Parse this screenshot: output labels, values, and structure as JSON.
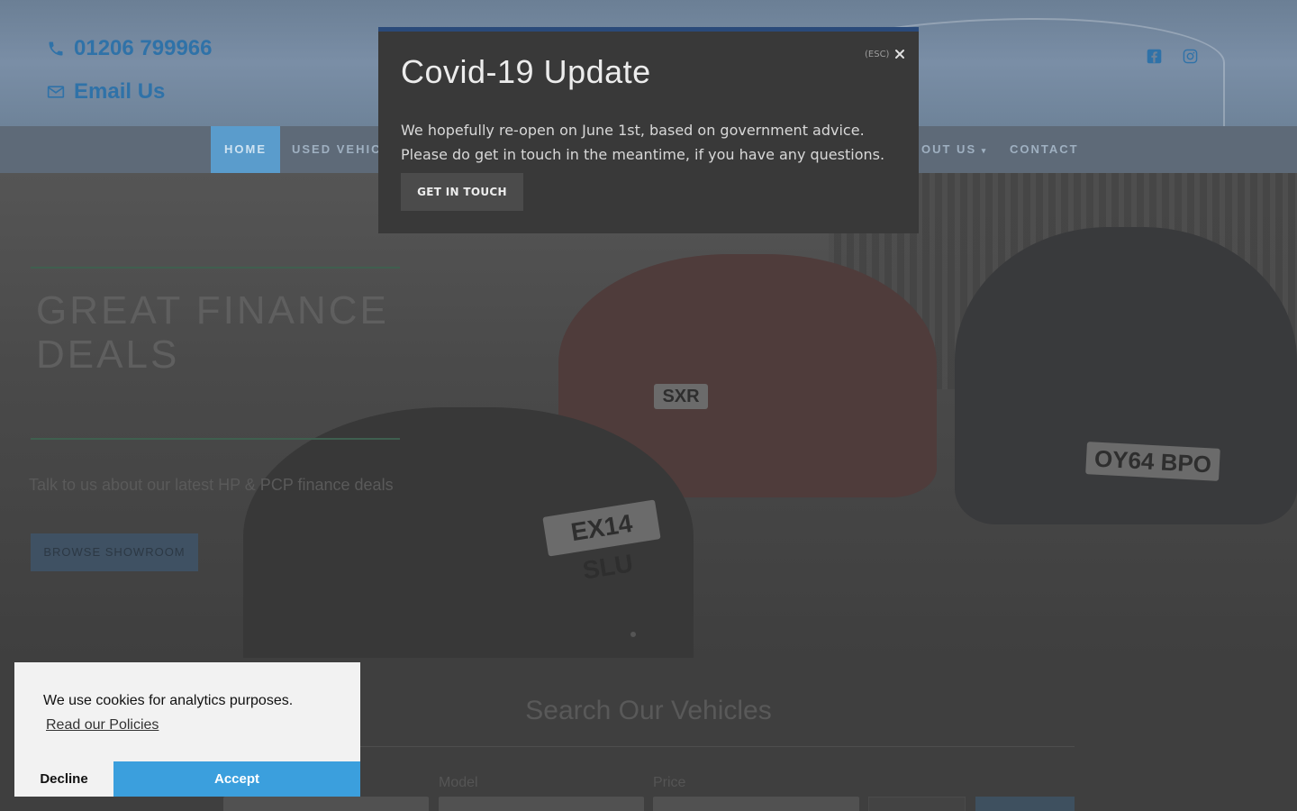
{
  "header": {
    "phone": "01206 799966",
    "email_label": "Email Us",
    "social": [
      "facebook-icon",
      "instagram-icon"
    ]
  },
  "nav": {
    "items": [
      {
        "label": "HOME",
        "active": true
      },
      {
        "label": "USED VEHICL",
        "active": false
      },
      {
        "label": "OUT US",
        "active": false
      },
      {
        "label": "CONTACT",
        "active": false
      }
    ]
  },
  "hero": {
    "title": "GREAT FINANCE DEALS",
    "subtitle": "Talk to us about our latest HP & PCP finance deals",
    "button_label": "BROWSE SHOWROOM",
    "plates": [
      "EX14 SLU",
      "SXR",
      "OY64 BPO"
    ]
  },
  "search": {
    "title": "Search Our Vehicles",
    "fields": [
      {
        "label": ""
      },
      {
        "label": "Model"
      },
      {
        "label": "Price"
      }
    ]
  },
  "modal": {
    "title": "Covid-19 Update",
    "body": "We hopefully re-open on June 1st, based on government advice. Please do get in touch in the meantime, if you have any questions.",
    "button_label": "GET IN TOUCH",
    "esc_label": "(ESC)"
  },
  "cookie": {
    "message": "We use cookies for analytics purposes.",
    "link_label": "Read our Policies",
    "decline_label": "Decline",
    "accept_label": "Accept"
  },
  "colors": {
    "accent": "#3b9fdd",
    "modal_bg": "#393939",
    "modal_border": "#2a4a7a"
  }
}
